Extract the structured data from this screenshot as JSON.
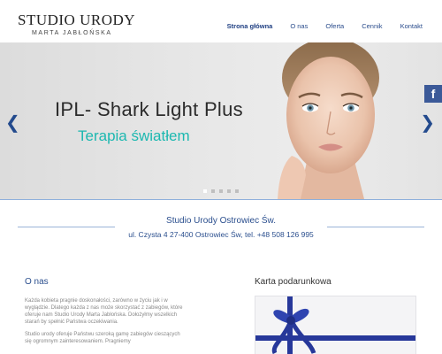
{
  "logo": {
    "title": "STUDIO URODY",
    "subtitle": "MARTA JABŁOŃSKA"
  },
  "nav": {
    "items": [
      {
        "label": "Strona główna",
        "active": true
      },
      {
        "label": "O nas"
      },
      {
        "label": "Oferta"
      },
      {
        "label": "Cennik"
      },
      {
        "label": "Kontakt"
      }
    ]
  },
  "slider": {
    "title": "IPL- Shark Light Plus",
    "subtitle": "Terapia światłem",
    "prev_icon": "chevron-left-icon",
    "next_icon": "chevron-right-icon",
    "prev_glyph": "❮",
    "next_glyph": "❯",
    "slide_count": 5,
    "active_slide": 1,
    "colors": {
      "subtitle": "#1cb8b0",
      "arrows": "#234a8d"
    }
  },
  "social": {
    "facebook_glyph": "f",
    "icon": "facebook-icon"
  },
  "info": {
    "title": "Studio Urody Ostrowiec Św.",
    "address": "ul. Czysta 4 27-400 Ostrowiec Św, tel. +48 508 126 995"
  },
  "about": {
    "title": "O nas",
    "paragraph1": "Każda kobieta pragnie doskonałości, zarówno w życiu jak i w wyglądzie. Dlatego każda z nas może skorzystać z zabiegów, które oferuje nam Studio Urody Marta Jabłońska. Dołożyłmy wszelkich starań by spełnić Państwa oczekiwania.",
    "paragraph2": "Studio urody oferuje Państwu szeroką gamę zabiegów cieszących się ogromnym zainteresowaniem. Pragniemy"
  },
  "gift_card": {
    "title": "Karta podarunkowa",
    "ribbon_color": "#27389a"
  },
  "colors": {
    "accent": "#2b4f8e",
    "nav_active": "#1f3f82",
    "facebook": "#3b5998"
  }
}
